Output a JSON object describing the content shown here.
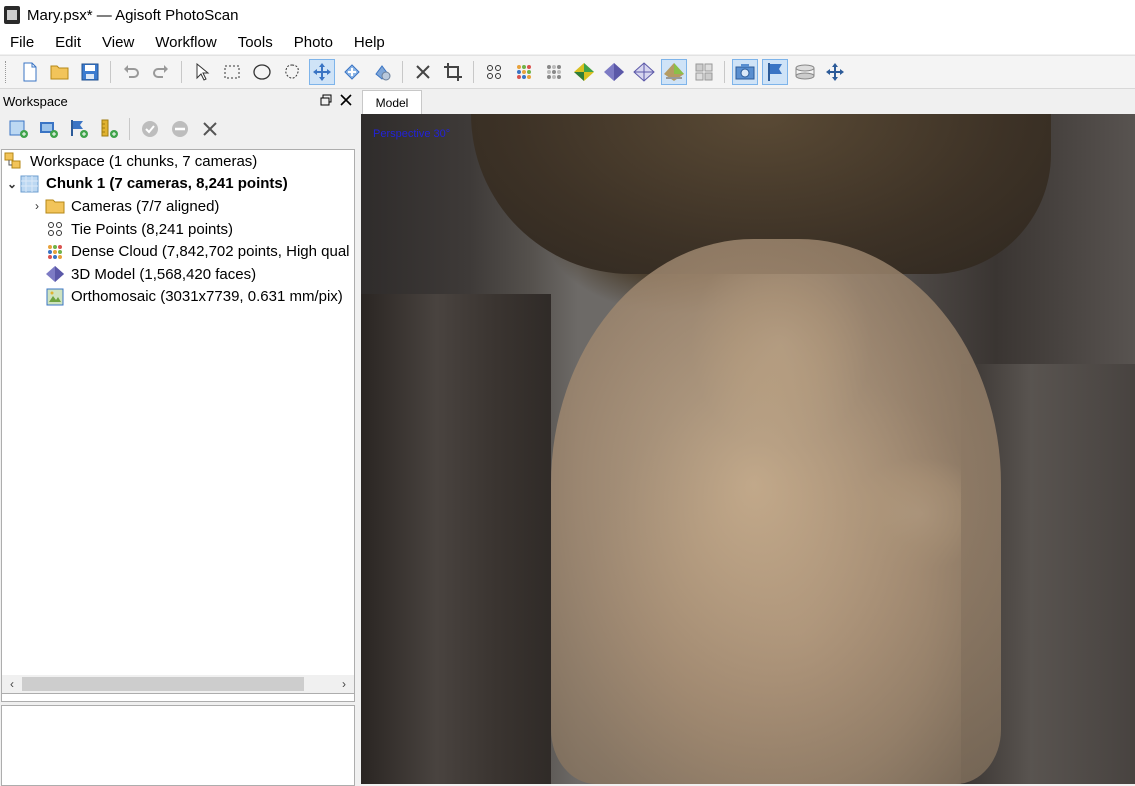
{
  "window": {
    "title": "Mary.psx* — Agisoft PhotoScan"
  },
  "menu": [
    "File",
    "Edit",
    "View",
    "Workflow",
    "Tools",
    "Photo",
    "Help"
  ],
  "toolbar": {
    "groups": [
      [
        "new-icon",
        "open-icon",
        "save-icon"
      ],
      [
        "undo-icon",
        "redo-icon"
      ],
      [
        "pointer-icon",
        "rect-select-icon",
        "circle-select-icon",
        "free-select-icon",
        "navigation-icon",
        "move-region-icon",
        "rotate-region-icon"
      ],
      [
        "delete-icon",
        "crop-icon"
      ],
      [
        "point-cloud-icon",
        "dense-cloud-icon",
        "dense-cloud-classes-icon",
        "shaded-model-icon",
        "solid-model-icon",
        "wireframe-model-icon",
        "textured-model-icon",
        "tiled-model-icon"
      ],
      [
        "show-cameras-icon",
        "show-markers-icon",
        "show-region-icon",
        "reset-view-icon"
      ]
    ],
    "active": [
      "navigation-icon",
      "textured-model-icon",
      "show-cameras-icon",
      "show-markers-icon"
    ]
  },
  "workspace": {
    "header": "Workspace",
    "tools": [
      "add-chunk-icon",
      "add-photos-icon",
      "add-markers-icon",
      "add-scalebar-icon",
      "enable-icon",
      "disable-icon",
      "remove-icon"
    ],
    "tree": [
      {
        "label": "Workspace (1 chunks, 7 cameras)",
        "icon": "workspace-icon",
        "level": 0,
        "expander": "",
        "bold": false
      },
      {
        "label": "Chunk 1 (7 cameras, 8,241 points)",
        "icon": "chunk-icon",
        "level": 0,
        "expander": "⌄",
        "bold": true
      },
      {
        "label": "Cameras (7/7 aligned)",
        "icon": "folder-icon",
        "level": 1,
        "expander": "›",
        "bold": false
      },
      {
        "label": "Tie Points (8,241 points)",
        "icon": "tie-points-icon",
        "level": 1,
        "expander": "",
        "bold": false
      },
      {
        "label": "Dense Cloud (7,842,702 points, High qual",
        "icon": "dense-cloud-icon",
        "level": 1,
        "expander": "",
        "bold": false
      },
      {
        "label": "3D Model (1,568,420 faces)",
        "icon": "model-icon",
        "level": 1,
        "expander": "",
        "bold": false
      },
      {
        "label": "Orthomosaic (3031x7739, 0.631 mm/pix)",
        "icon": "orthomosaic-icon",
        "level": 1,
        "expander": "",
        "bold": false
      }
    ]
  },
  "view": {
    "tab": "Model",
    "projection": "Perspective 30°"
  },
  "colors": {
    "accent": "#2222d8",
    "active_button": "#cfe3f7"
  }
}
